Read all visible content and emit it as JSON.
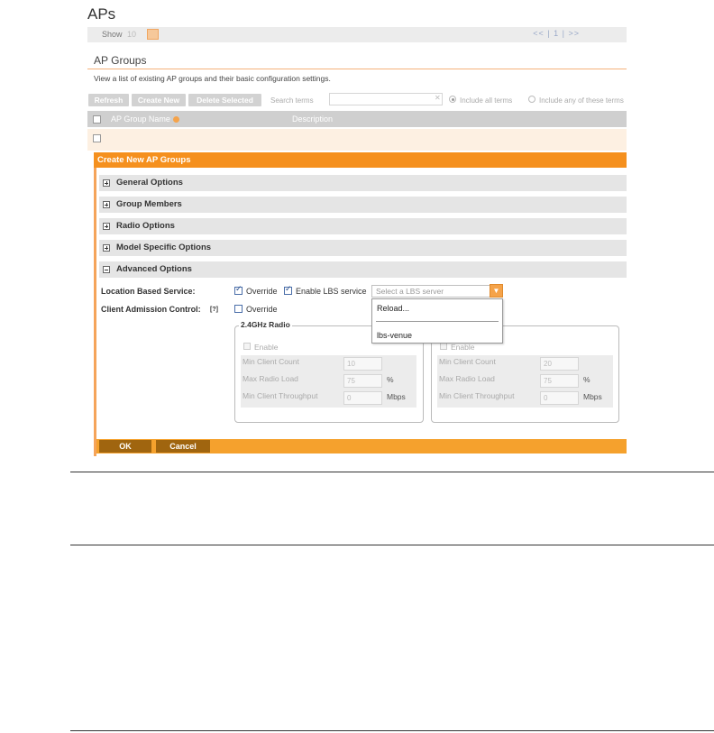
{
  "page": {
    "title": "APs"
  },
  "showbar": {
    "show_label": "Show",
    "show_value": "10",
    "pagination": "<< | 1 | >>"
  },
  "section": {
    "title": "AP Groups",
    "description": "View a list of existing AP groups and their basic configuration settings."
  },
  "toolbar": {
    "refresh": "Refresh",
    "create_new": "Create New",
    "delete_selected": "Delete Selected",
    "search_label": "Search terms",
    "search_value": "",
    "include_all": "Include all terms",
    "include_any": "Include any of these terms"
  },
  "table": {
    "columns": [
      "AP Group Name",
      "Description"
    ]
  },
  "panel": {
    "title": "Create New AP Groups",
    "sections": [
      {
        "label": "General Options",
        "expanded": false
      },
      {
        "label": "Group Members",
        "expanded": false
      },
      {
        "label": "Radio Options",
        "expanded": false
      },
      {
        "label": "Model Specific Options",
        "expanded": false
      },
      {
        "label": "Advanced Options",
        "expanded": true
      }
    ],
    "lbs": {
      "label": "Location Based Service:",
      "override_label": "Override",
      "override_checked": true,
      "enable_label": "Enable LBS service",
      "enable_checked": true,
      "select_placeholder": "Select a LBS server",
      "dropdown_options": [
        "Reload...",
        "lbs-venue"
      ]
    },
    "cac": {
      "label": "Client Admission Control:",
      "help": "[?]",
      "override_label": "Override",
      "override_checked": false,
      "radio_24": {
        "legend": "2.4GHz Radio",
        "enable_label": "Enable",
        "min_client_count_label": "Min Client Count",
        "min_client_count": "10",
        "max_radio_load_label": "Max Radio Load",
        "max_radio_load": "75",
        "max_radio_load_unit": "%",
        "min_throughput_label": "Min Client Throughput",
        "min_throughput": "0",
        "min_throughput_unit": "Mbps"
      },
      "radio_5": {
        "enable_label": "Enable",
        "min_client_count_label": "Min Client Count",
        "min_client_count": "20",
        "max_radio_load_label": "Max Radio Load",
        "max_radio_load": "75",
        "max_radio_load_unit": "%",
        "min_throughput_label": "Min Client Throughput",
        "min_throughput": "0",
        "min_throughput_unit": "Mbps"
      }
    },
    "ok": "OK",
    "cancel": "Cancel"
  },
  "colors": {
    "accent": "#f5901e",
    "button_dark": "#a0650f",
    "header_gray": "#cfcfcf"
  }
}
